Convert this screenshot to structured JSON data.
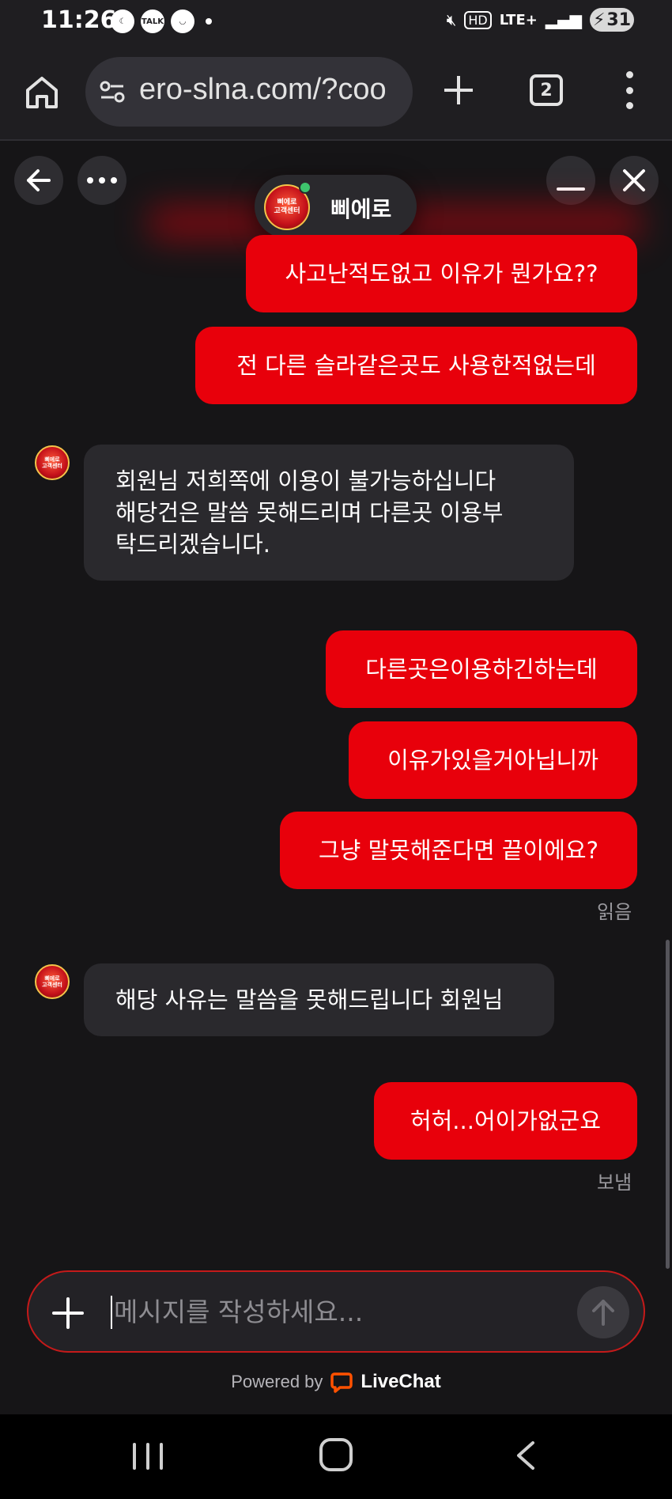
{
  "status_bar": {
    "time": "11:26",
    "talk_badge": "TALK",
    "network": "LTE+",
    "hd": "HD",
    "battery": "31"
  },
  "browser": {
    "url": "ero-slna.com/?coo",
    "tab_count": "2"
  },
  "chat": {
    "agent_name": "삐에로",
    "avatar_text": "삐에로\n고객센터",
    "messages": [
      {
        "from": "visitor",
        "text": "사고난적도없고 이유가 뭔가요??"
      },
      {
        "from": "visitor",
        "text": "전 다른 슬라같은곳도 사용한적없는데"
      },
      {
        "from": "agent",
        "lines": [
          "회원님 저희쪽에 이용이 불가능하십니다",
          "해당건은 말씀 못해드리며 다른곳 이용부",
          "탁드리겠습니다."
        ]
      },
      {
        "from": "visitor",
        "text": "다른곳은이용하긴하는데"
      },
      {
        "from": "visitor",
        "text": "이유가있을거아닙니까"
      },
      {
        "from": "visitor",
        "text": "그냥 말못해준다면 끝이에요?"
      },
      {
        "from": "agent",
        "lines": [
          "해당 사유는 말씀을 못해드립니다 회원님"
        ]
      },
      {
        "from": "visitor",
        "text": "허허...어이가없군요"
      }
    ],
    "read_label": "읽음",
    "sent_label": "보냄"
  },
  "composer": {
    "placeholder": "메시지를 작성하세요..."
  },
  "footer": {
    "powered_by": "Powered by",
    "brand": "LiveChat"
  },
  "colors": {
    "accent": "#e8000b",
    "background": "#161517",
    "agent_bubble": "#2a292d",
    "online": "#3ec46d"
  }
}
